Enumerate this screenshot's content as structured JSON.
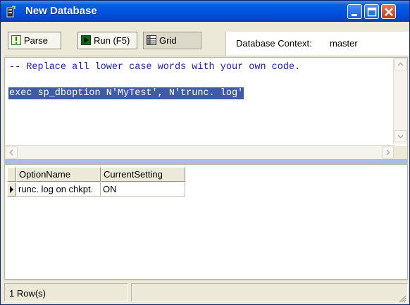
{
  "window": {
    "title": "New Database"
  },
  "toolbar": {
    "parse_label": "Parse",
    "run_label": "Run (F5)",
    "grid_label": "Grid",
    "context_label": "Database Context:",
    "context_value": "master"
  },
  "editor": {
    "line1": "-- Replace all lower case words with your own code.",
    "line2": "exec sp_dboption N'MyTest', N'trunc. log'"
  },
  "results": {
    "columns": [
      "OptionName",
      "CurrentSetting"
    ],
    "rows": [
      [
        "runc. log on chkpt.",
        "ON"
      ]
    ]
  },
  "status": {
    "rows": "1 Row(s)"
  },
  "colors": {
    "titlebar": "#0054e3",
    "selection": "#3f5aa8",
    "code": "#1c1cb0",
    "splitter": "#a7bde6"
  },
  "icons": [
    "db-window-icon",
    "minimize-icon",
    "maximize-icon",
    "close-icon",
    "parse-icon",
    "run-icon",
    "grid-icon",
    "row-pointer-icon",
    "size-grip-icon"
  ]
}
